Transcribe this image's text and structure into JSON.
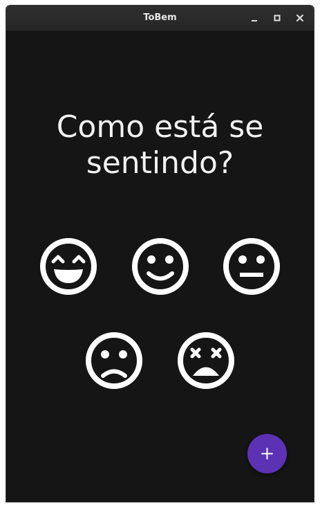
{
  "window": {
    "title": "ToBem",
    "controls": [
      "minimize-icon",
      "maximize-icon",
      "close-icon"
    ]
  },
  "main": {
    "question_line1": "Como está se",
    "question_line2": "sentindo?",
    "moods": [
      {
        "name": "very-happy",
        "icon": "grinning-squint-face-icon"
      },
      {
        "name": "happy",
        "icon": "smiling-face-icon"
      },
      {
        "name": "neutral",
        "icon": "neutral-face-icon"
      },
      {
        "name": "sad",
        "icon": "sad-face-icon"
      },
      {
        "name": "very-sad",
        "icon": "dizzy-face-icon"
      }
    ]
  },
  "fab": {
    "icon": "plus-icon"
  },
  "colors": {
    "background": "#151515",
    "titlebar": "#2a2a2a",
    "text": "#f2f2f2",
    "fab": "#5b32b4"
  }
}
